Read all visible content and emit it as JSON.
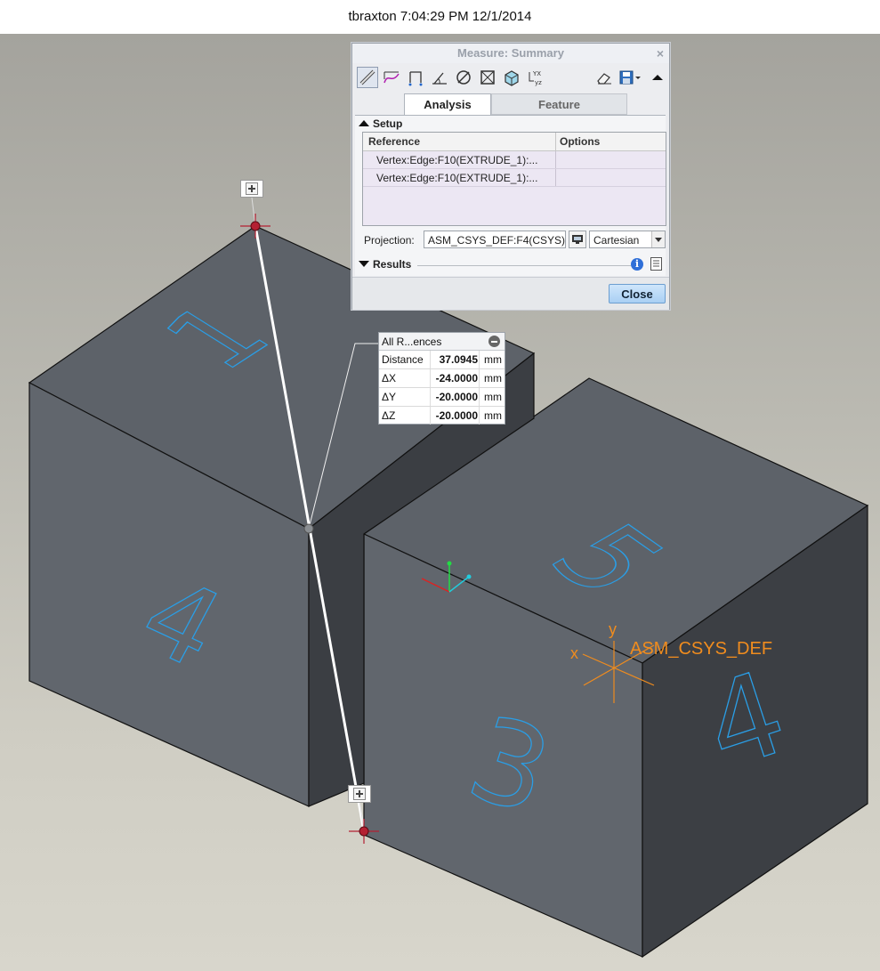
{
  "header": {
    "text": "tbraxton 7:04:29 PM 12/1/2014"
  },
  "dialog": {
    "title": "Measure: Summary",
    "close_glyph": "×",
    "toolbar_icons": [
      "length-icon",
      "distance-icon",
      "angle-icon",
      "radius-icon",
      "diameter-icon",
      "area-icon",
      "volume-icon",
      "transform-icon",
      "eraser-icon",
      "save-icon",
      "collapse-toolbar-icon"
    ],
    "tabs": [
      {
        "label": "Analysis",
        "active": true
      },
      {
        "label": "Feature",
        "active": false
      }
    ],
    "setup": {
      "label": "Setup",
      "columns": [
        "Reference",
        "Options"
      ],
      "rows": [
        "Vertex:Edge:F10(EXTRUDE_1):...",
        "Vertex:Edge:F10(EXTRUDE_1):..."
      ]
    },
    "projection": {
      "label": "Projection:",
      "value": "ASM_CSYS_DEF:F4(CSYS)",
      "mode": "Cartesian"
    },
    "results": {
      "label": "Results"
    },
    "close_button": "Close"
  },
  "callout": {
    "title": "All R...ences",
    "rows": [
      {
        "label": "Distance",
        "value": "37.0945",
        "unit": "mm"
      },
      {
        "label": "ΔX",
        "value": "-24.0000",
        "unit": "mm"
      },
      {
        "label": "ΔY",
        "value": "-20.0000",
        "unit": "mm"
      },
      {
        "label": "ΔZ",
        "value": "-20.0000",
        "unit": "mm"
      }
    ]
  },
  "scene": {
    "csys_label": "ASM_CSYS_DEF",
    "csys_axis_x": "x",
    "csys_axis_y": "y",
    "face_numbers": {
      "cube1_top": "1",
      "cube1_front": "4",
      "cube2_top": "5",
      "cube2_front": "3",
      "cube2_side": "4"
    },
    "colors": {
      "face_top": "#5e636a",
      "face_front": "#62676e",
      "face_side": "#3c3f44",
      "edge": "#111111",
      "numeral": "#2a9ee6",
      "csys": "#f08c1e",
      "measure_line": "#ffffff",
      "vertex_marker": "#b42032"
    }
  }
}
